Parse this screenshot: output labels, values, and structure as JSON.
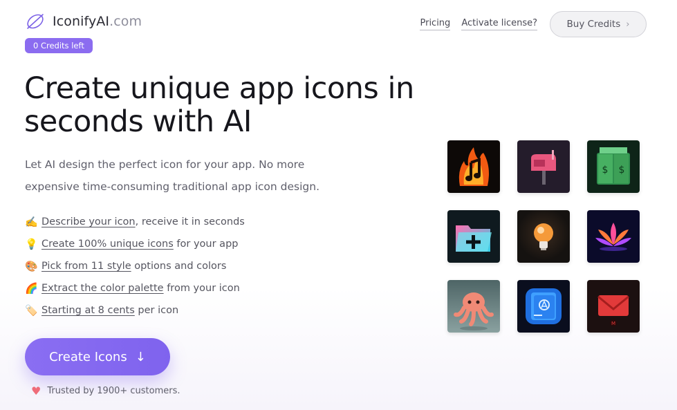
{
  "header": {
    "logo_name": "IconifyAI",
    "logo_domain": ".com",
    "credits_badge": "0 Credits left",
    "nav": {
      "pricing": "Pricing",
      "activate": "Activate license?",
      "buy_credits": "Buy Credits"
    }
  },
  "hero": {
    "headline": "Create unique app icons in seconds with AI",
    "subhead": "Let AI design the perfect icon for your app. No more expensive time-consuming traditional app icon design.",
    "features": [
      {
        "emoji": "✍️",
        "link": "Describe your icon",
        "rest": ", receive it in seconds"
      },
      {
        "emoji": "💡",
        "link": "Create 100% unique icons",
        "rest": " for your app"
      },
      {
        "emoji": "🎨",
        "link": "Pick from 11 style",
        "rest": " options and colors"
      },
      {
        "emoji": "🌈",
        "link": "Extract the color palette",
        "rest": " from your icon"
      },
      {
        "emoji": "🏷️",
        "link": "Starting at 8 cents",
        "rest": " per icon"
      }
    ],
    "cta_label": "Create Icons",
    "trusted": "Trusted by 1900+ customers."
  },
  "icons": [
    "fire-music-note-icon",
    "mailbox-icon",
    "money-book-icon",
    "folder-plus-icon",
    "lightbulb-icon",
    "lotus-icon",
    "octopus-icon",
    "app-store-book-icon",
    "gmail-envelope-icon"
  ],
  "colors": {
    "accent": "#8b6cf0",
    "heart": "#ef6c79"
  }
}
